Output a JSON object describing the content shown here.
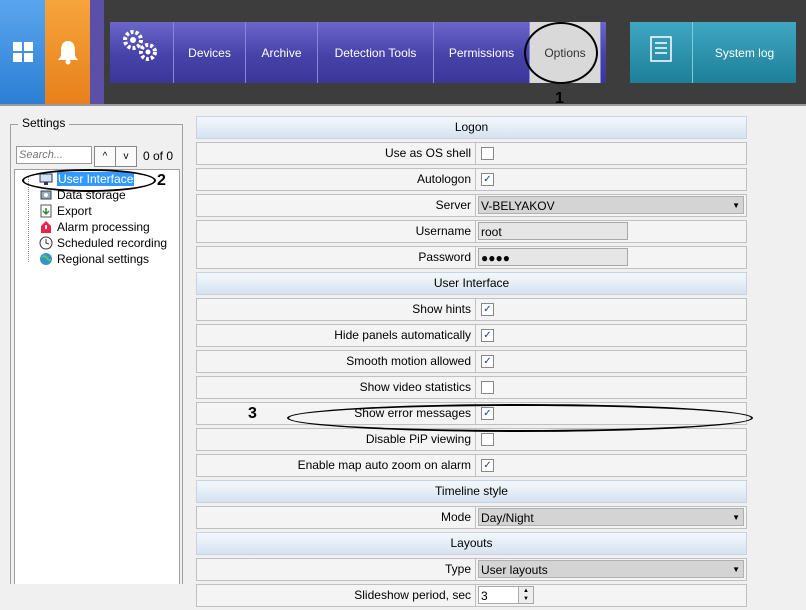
{
  "topbar": {
    "nav": [
      "Devices",
      "Archive",
      "Detection Tools",
      "Permissions",
      "Options"
    ],
    "active": "Options",
    "system_log": "System log"
  },
  "callouts": {
    "one": "1",
    "two": "2",
    "three": "3"
  },
  "settings": {
    "title": "Settings",
    "search_placeholder": "Search...",
    "up": "^",
    "down": "v",
    "count": "0 of 0",
    "tree": [
      {
        "label": "User Interface",
        "icon": "monitor-icon",
        "selected": true
      },
      {
        "label": "Data storage",
        "icon": "storage-icon"
      },
      {
        "label": "Export",
        "icon": "export-icon"
      },
      {
        "label": "Alarm processing",
        "icon": "alarm-icon"
      },
      {
        "label": "Scheduled recording",
        "icon": "clock-icon"
      },
      {
        "label": "Regional settings",
        "icon": "globe-icon"
      }
    ]
  },
  "form": {
    "logon": {
      "title": "Logon",
      "use_os_shell": {
        "label": "Use as OS shell",
        "checked": false
      },
      "autologon": {
        "label": "Autologon",
        "checked": true
      },
      "server": {
        "label": "Server",
        "value": "V-BELYAKOV"
      },
      "username": {
        "label": "Username",
        "value": "root"
      },
      "password": {
        "label": "Password",
        "value": "●●●●"
      }
    },
    "ui": {
      "title": "User Interface",
      "show_hints": {
        "label": "Show hints",
        "checked": true
      },
      "hide_panels": {
        "label": "Hide panels automatically",
        "checked": true
      },
      "smooth_motion": {
        "label": "Smooth motion allowed",
        "checked": true
      },
      "show_video_stats": {
        "label": "Show video statistics",
        "checked": false
      },
      "show_errors": {
        "label": "Show error messages",
        "checked": true
      },
      "disable_pip": {
        "label": "Disable PiP viewing",
        "checked": false
      },
      "map_auto_zoom": {
        "label": "Enable map auto zoom on alarm",
        "checked": true
      }
    },
    "timeline": {
      "title": "Timeline style",
      "mode": {
        "label": "Mode",
        "value": "Day/Night"
      }
    },
    "layouts": {
      "title": "Layouts",
      "type": {
        "label": "Type",
        "value": "User layouts"
      },
      "slideshow": {
        "label": "Slideshow period, sec",
        "value": "3"
      }
    }
  }
}
